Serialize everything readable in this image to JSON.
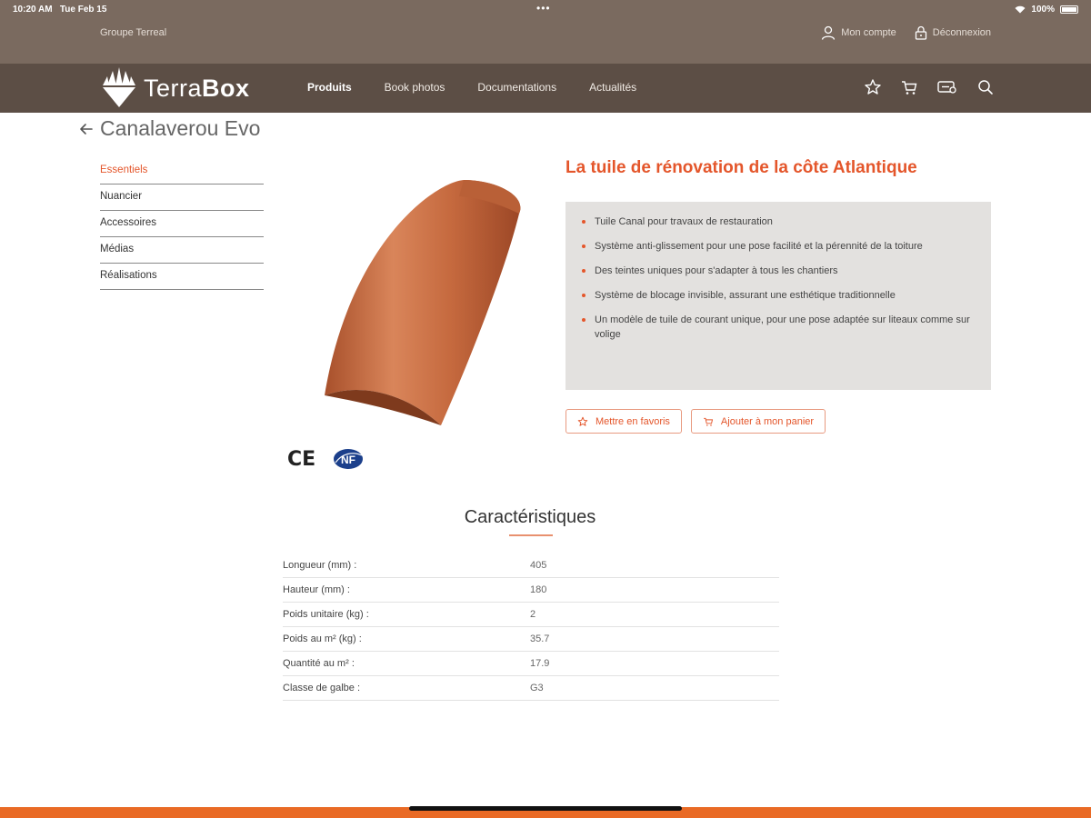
{
  "status_bar": {
    "time": "10:20 AM",
    "date": "Tue Feb 15",
    "dots": "•••",
    "battery": "100%"
  },
  "header": {
    "group_name": "Groupe Terreal",
    "account_label": "Mon compte",
    "logout_label": "Déconnexion"
  },
  "nav": {
    "logo_terra": "Terra",
    "logo_box": "Box",
    "items": [
      {
        "label": "Produits"
      },
      {
        "label": "Book photos"
      },
      {
        "label": "Documentations"
      },
      {
        "label": "Actualités"
      }
    ],
    "icons": [
      "star-icon",
      "cart-icon",
      "project-icon",
      "search-icon"
    ]
  },
  "page": {
    "title": "Canalaverou Evo"
  },
  "side_menu": {
    "items": [
      {
        "label": "Essentiels"
      },
      {
        "label": "Nuancier"
      },
      {
        "label": "Accessoires"
      },
      {
        "label": "Médias"
      },
      {
        "label": "Réalisations"
      }
    ]
  },
  "product": {
    "headline": "La tuile de rénovation de la côte Atlantique",
    "features": [
      "Tuile Canal pour travaux de restauration",
      "Système anti-glissement pour une pose facilité et la pérennité de la toiture",
      "Des teintes uniques pour s'adapter à tous les chantiers",
      "Système de blocage invisible, assurant une esthétique traditionnelle",
      "Un modèle de tuile de courant unique, pour une pose adaptée sur liteaux comme sur volige"
    ],
    "favorite_button": "Mettre en favoris",
    "cart_button": "Ajouter à mon panier",
    "cert_ce": "CE",
    "cert_nf": "NF"
  },
  "characteristics": {
    "title": "Caractéristiques",
    "rows": [
      {
        "label": "Longueur (mm) :",
        "value": "405"
      },
      {
        "label": "Hauteur (mm) :",
        "value": "180"
      },
      {
        "label": "Poids unitaire (kg) :",
        "value": "2"
      },
      {
        "label": "Poids au m² (kg) :",
        "value": "35.7"
      },
      {
        "label": "Quantité au m² :",
        "value": "17.9"
      },
      {
        "label": "Classe de galbe :",
        "value": "G3"
      }
    ]
  },
  "colors": {
    "accent": "#e4562b",
    "topbar": "#7a6a5f",
    "navbar": "#5c4e45",
    "footer": "#e96a25"
  }
}
